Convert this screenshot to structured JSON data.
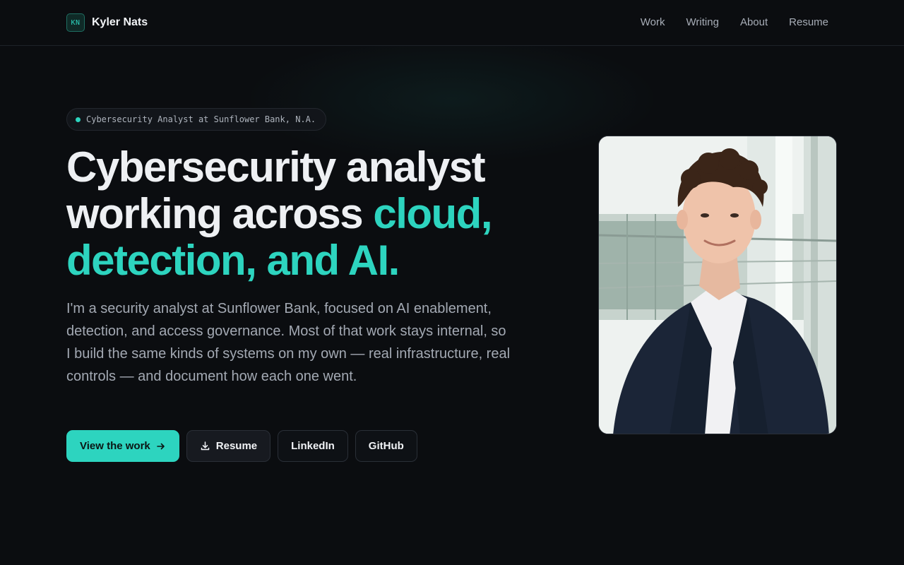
{
  "nav": {
    "logo_text": "KN",
    "brand": "Kyler Nats",
    "links": [
      {
        "label": "Work"
      },
      {
        "label": "Writing"
      },
      {
        "label": "About"
      },
      {
        "label": "Resume"
      }
    ]
  },
  "hero": {
    "badge": "Cybersecurity Analyst at Sunflower Bank, N.A.",
    "headline_plain": "Cybersecurity analyst working across ",
    "headline_accent": "cloud, detection, and AI.",
    "lead": "I'm a security analyst at Sunflower Bank, focused on AI enablement, detection, and access governance. Most of that work stays internal, so I build the same kinds of systems on my own — real infrastructure, real controls — and document how each one went.",
    "buttons": {
      "view_work": "View the work",
      "resume": "Resume",
      "linkedin": "LinkedIn",
      "github": "GitHub"
    }
  },
  "colors": {
    "accent": "#2dd4bf",
    "background": "#0b0d10"
  },
  "icons": {
    "arrow": "arrow-right-icon",
    "download": "download-icon",
    "status": "status-dot-icon"
  }
}
